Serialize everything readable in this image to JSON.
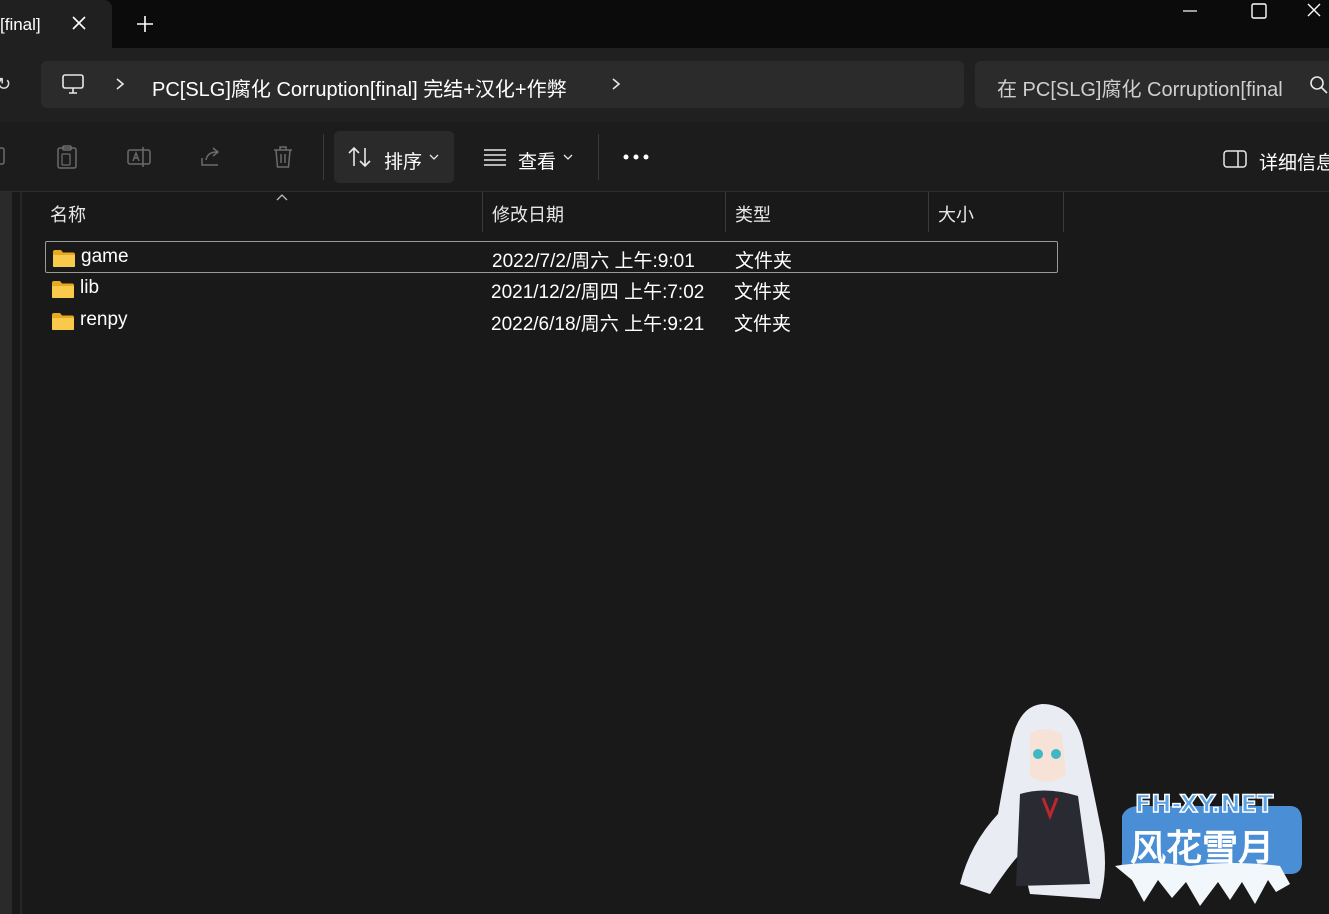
{
  "tab": {
    "label": "[final]"
  },
  "addressbar": {
    "path": "PC[SLG]腐化 Corruption[final] 完结+汉化+作弊"
  },
  "search": {
    "placeholder": "在 PC[SLG]腐化 Corruption[final] 中搜索"
  },
  "toolbar": {
    "sort_label": "排序",
    "view_label": "查看",
    "details_label": "详细信息"
  },
  "columns": {
    "name": "名称",
    "date": "修改日期",
    "type": "类型",
    "size": "大小"
  },
  "files": [
    {
      "name": "game",
      "date": "2022/7/2/周六 上午:9:01",
      "type": "文件夹",
      "size": ""
    },
    {
      "name": "lib",
      "date": "2021/12/2/周四 上午:7:02",
      "type": "文件夹",
      "size": ""
    },
    {
      "name": "renpy",
      "date": "2022/6/18/周六 上午:9:21",
      "type": "文件夹",
      "size": ""
    }
  ],
  "watermark": {
    "domain": "FH-XY.NET",
    "title": "风花雪月"
  },
  "colors": {
    "folder": "#f6c340",
    "background": "#191919",
    "accent": "#2f6fb8"
  }
}
